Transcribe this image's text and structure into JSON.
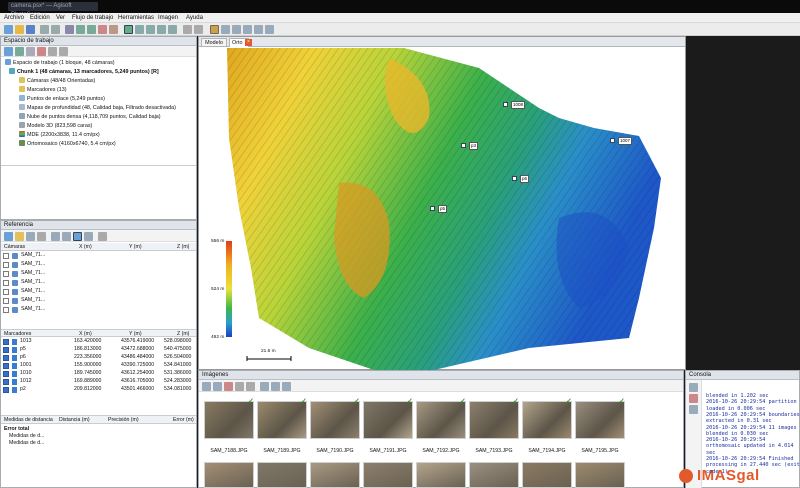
{
  "window": {
    "title": "camera.psx* — Agisoft PhotoScan"
  },
  "menu": [
    "Archivo",
    "Edición",
    "Ver",
    "Flujo de trabajo",
    "Herramientas",
    "Imagen",
    "Ayuda"
  ],
  "workspace": {
    "title": "Espacio de trabajo",
    "root": "Espacio de trabajo (1 bloque, 48 cámaras)",
    "chunk": "Chunk 1 (48 cámaras, 13 marcadores, 5,249 puntos) [R]",
    "items": [
      "Cámaras (48/48 Orientadas)",
      "Marcadores (13)",
      "Puntos de enlace (5,249 puntos)",
      "Mapas de profundidad (48, Calidad baja, Filtrado desactivada)",
      "Nube de puntos densa (4,118,709 puntos, Calidad baja)",
      "Modelo 3D (823,598 caras)",
      "MDE (2200x3838, 11.4 cm/px)",
      "Ortomosaico (4160x6740, 5.4 cm/px)"
    ]
  },
  "reference": {
    "title": "Referencia",
    "cameras_headers": [
      "Cámaras",
      "X (m)",
      "Y (m)",
      "Z (m)"
    ],
    "cameras": [
      "SAM_71...",
      "SAM_71...",
      "SAM_71...",
      "SAM_71...",
      "SAM_71...",
      "SAM_71...",
      "SAM_71..."
    ],
    "markers_headers": [
      "Marcadores",
      "X (m)",
      "Y (m)",
      "Z (m)"
    ],
    "markers": [
      {
        "name": "1013",
        "x": "163.420000",
        "y": "43576.419000",
        "z": "528.098000"
      },
      {
        "name": "p5",
        "x": "186.813000",
        "y": "43472.688000",
        "z": "540.475000"
      },
      {
        "name": "p6",
        "x": "223.356000",
        "y": "43486.484000",
        "z": "526.504000"
      },
      {
        "name": "1001",
        "x": "155.900000",
        "y": "43390.725000",
        "z": "534.841000"
      },
      {
        "name": "1010",
        "x": "189.745000",
        "y": "43612.254000",
        "z": "531.386000"
      },
      {
        "name": "1012",
        "x": "169.889000",
        "y": "43616.705000",
        "z": "524.283000"
      },
      {
        "name": "p2",
        "x": "209.812000",
        "y": "43501.466000",
        "z": "534.081000"
      }
    ],
    "scale_headers": [
      "Medidas de distancia",
      "Distancia (m)",
      "Precisión (m)",
      "Error (m)"
    ],
    "scale_rows": [
      "Error total",
      "Medidas de d...",
      "Medidas de d..."
    ]
  },
  "view_tabs": {
    "model": "Modelo",
    "ortho": "Orto"
  },
  "legend": {
    "top": "556 m",
    "mid": "524 m",
    "bottom": "492 m"
  },
  "scalebar": {
    "label": "21.6 m"
  },
  "markers_map": [
    {
      "label": "1008"
    },
    {
      "label": "p3"
    },
    {
      "label": "1007"
    },
    {
      "label": "p6"
    },
    {
      "label": "p5"
    }
  ],
  "images": {
    "title": "Imágenes",
    "items": [
      "SAM_7188.JPG",
      "SAM_7189.JPG",
      "SAM_7190.JPG",
      "SAM_7191.JPG",
      "SAM_7192.JPG",
      "SAM_7193.JPG",
      "SAM_7194.JPG",
      "SAM_7195.JPG"
    ]
  },
  "console": {
    "title": "Consola",
    "lines": [
      "blended in 1.202 sec",
      "2016-10-26 20:29:54 partition",
      "loaded in 0.006 sec",
      "2016-10-26 20:29:54 boundaries",
      "extracted in 0.31 sec",
      "2016-10-26 20:29:54 11 images",
      "blended in 0.030 sec",
      "2016-10-26 20:29:54",
      "orthomosaic updated in 4.014",
      "sec",
      "2016-10-26 20:29:54 Finished",
      "processing in 27.440 sec (exit",
      "code 1)"
    ]
  },
  "brand": {
    "logo_text": "IMASgal"
  },
  "colors": {
    "accent_orange": "#e25a2c",
    "selection_blue": "#3a6fc7"
  }
}
